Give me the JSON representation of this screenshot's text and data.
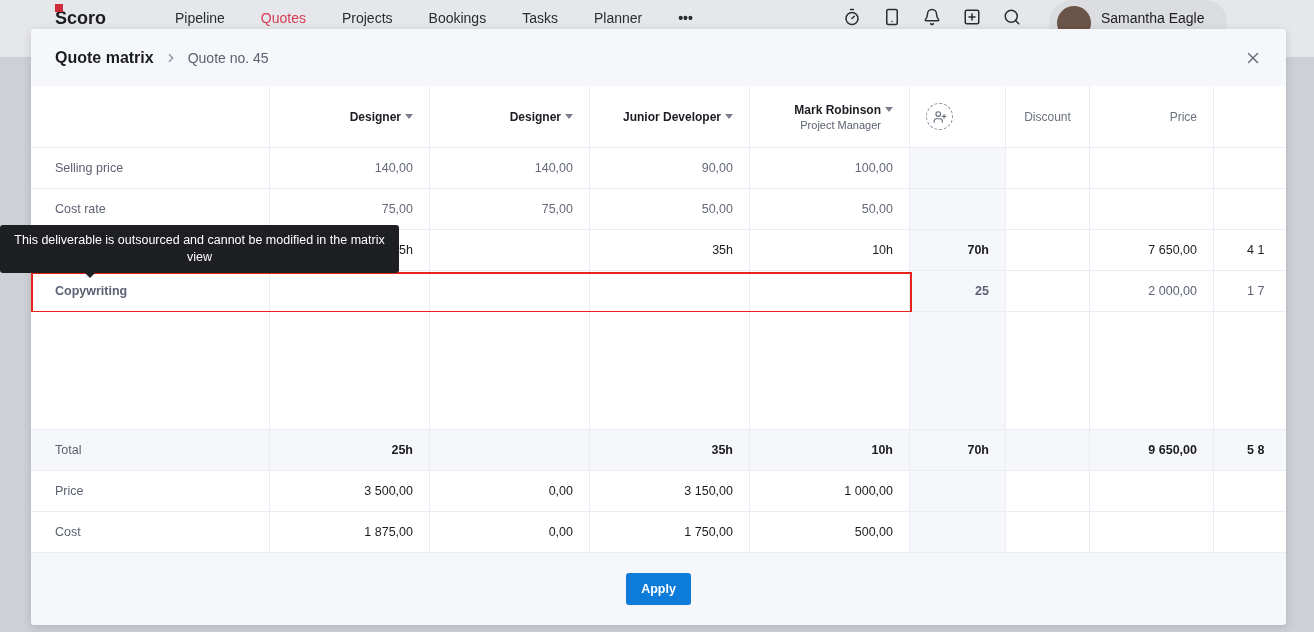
{
  "app_bar": {
    "logo": "Scoro",
    "nav": [
      {
        "label": "Pipeline",
        "selected": false
      },
      {
        "label": "Quotes",
        "selected": true
      },
      {
        "label": "Projects",
        "selected": false
      },
      {
        "label": "Bookings",
        "selected": false
      },
      {
        "label": "Tasks",
        "selected": false
      },
      {
        "label": "Planner",
        "selected": false
      }
    ],
    "more": "•••",
    "user": "Samantha Eagle"
  },
  "modal": {
    "title": "Quote matrix",
    "breadcrumb": "Quote no. 45",
    "columns": [
      {
        "kind": "role",
        "label": "Designer"
      },
      {
        "kind": "role",
        "label": "Designer"
      },
      {
        "kind": "role",
        "label": "Junior Developer"
      },
      {
        "kind": "role",
        "label": "Mark Robinson",
        "subtitle": "Project Manager"
      },
      {
        "kind": "add"
      },
      {
        "kind": "plain",
        "label": "Discount"
      },
      {
        "kind": "plain",
        "label": "Price"
      },
      {
        "kind": "blank"
      }
    ],
    "rows": [
      {
        "kind": "rate",
        "label": "Selling price",
        "cells": [
          "140,00",
          "140,00",
          "90,00",
          "100,00",
          null,
          null,
          null,
          null
        ]
      },
      {
        "kind": "rate",
        "label": "Cost rate",
        "cells": [
          "75,00",
          "75,00",
          "50,00",
          "50,00",
          null,
          null,
          null,
          null
        ]
      },
      {
        "kind": "task",
        "cells": [
          "5h",
          null,
          "35h",
          "10h",
          "70h",
          null,
          "7 650,00",
          "4 1"
        ]
      },
      {
        "kind": "outsourced",
        "label": "Copywriting",
        "highlighted": true,
        "cells": [
          null,
          null,
          null,
          null,
          "25",
          null,
          "2 000,00",
          "1 7"
        ]
      },
      {
        "kind": "filler",
        "cells": [
          null,
          null,
          null,
          null,
          null,
          null,
          null,
          null
        ]
      },
      {
        "kind": "total",
        "label": "Total",
        "cells": [
          "25h",
          null,
          "35h",
          "10h",
          "70h",
          null,
          "9 650,00",
          "5 8"
        ]
      },
      {
        "kind": "sum",
        "label": "Price",
        "cells": [
          "3 500,00",
          "0,00",
          "3 150,00",
          "1 000,00",
          null,
          null,
          null,
          null
        ]
      },
      {
        "kind": "sum",
        "label": "Cost",
        "cells": [
          "1 875,00",
          "0,00",
          "1 750,00",
          "500,00",
          null,
          null,
          null,
          null
        ]
      }
    ],
    "tooltip": "This deliverable is outsourced and cannot be modified in the matrix view",
    "apply_button": "Apply"
  }
}
